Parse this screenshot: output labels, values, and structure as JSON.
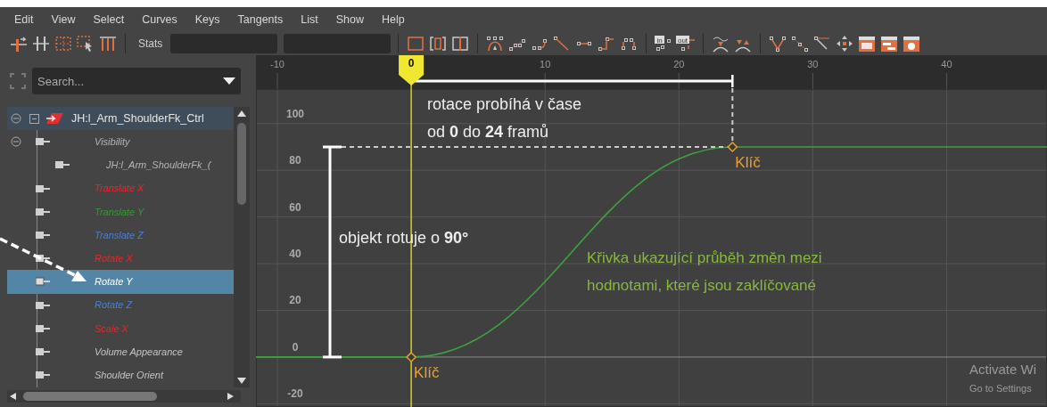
{
  "menu": [
    "Edit",
    "View",
    "Select",
    "Curves",
    "Keys",
    "Tangents",
    "List",
    "Show",
    "Help"
  ],
  "toolbar": {
    "stats_label": "Stats",
    "tangent_labels": [
      "in",
      "out"
    ]
  },
  "outliner": {
    "search": {
      "placeholder": "Search..."
    },
    "root": {
      "label": "JH:l_Arm_ShoulderFk_Ctrl",
      "expanded": true,
      "children": [
        {
          "label": "Visibility",
          "color": "#b4b4b4",
          "selected": false,
          "expanded": true,
          "children": [
            {
              "label": "JH:l_Arm_ShoulderFk_(",
              "color": "#b4b4b4",
              "selected": false
            }
          ]
        },
        {
          "label": "Translate X",
          "color": "#e8262b",
          "selected": false
        },
        {
          "label": "Translate Y",
          "color": "#2f9e2f",
          "selected": false
        },
        {
          "label": "Translate Z",
          "color": "#4a7fd8",
          "selected": false
        },
        {
          "label": "Rotate X",
          "color": "#e8262b",
          "selected": false
        },
        {
          "label": "Rotate Y",
          "color": "#ffffff",
          "selected": true
        },
        {
          "label": "Rotate Z",
          "color": "#4a7fd8",
          "selected": false
        },
        {
          "label": "Scale X",
          "color": "#e8262b",
          "selected": false
        },
        {
          "label": "Volume Appearance",
          "color": "#c4c4c4",
          "selected": false
        },
        {
          "label": "Shoulder Orient",
          "color": "#c4c4c4",
          "selected": false
        }
      ]
    }
  },
  "graph": {
    "time_marker": "0",
    "chart_data": {
      "type": "line",
      "x": [
        -11.6,
        0,
        24,
        47.5
      ],
      "series": [
        {
          "color": "#3fa03f",
          "values": [
            0,
            0,
            90,
            90
          ]
        }
      ],
      "xlim": [
        -11.6,
        47.5
      ],
      "ylim": [
        -21.4,
        114.8
      ],
      "xticks": [
        -10,
        10,
        20,
        30,
        40
      ],
      "yticks": [
        -20,
        0,
        20,
        40,
        60,
        80,
        100
      ],
      "grid": true,
      "ref_lines": [
        {
          "axis": "x",
          "value": 0,
          "color": "#d8d020"
        }
      ]
    },
    "keys": [
      {
        "label": "Klíč"
      },
      {
        "label": "Klíč"
      }
    ],
    "notes": [
      {
        "kind": "time",
        "lines": [
          "rotace probíhá v čase",
          "od **0** do **24** framů"
        ]
      },
      {
        "kind": "value",
        "lines": [
          "objekt rotuje o **90°**"
        ]
      },
      {
        "kind": "curve",
        "lines": [
          "Křivka ukazující průběh změn mezi",
          "hodnotami, které jsou zaklíčované"
        ]
      }
    ]
  },
  "os_notice": [
    "Activate Wi",
    "Go to Settings"
  ]
}
